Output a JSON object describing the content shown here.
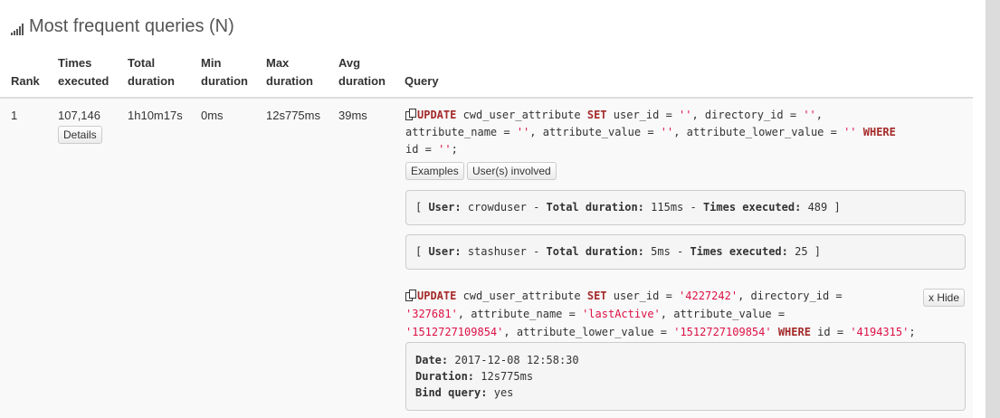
{
  "title": "Most frequent queries (N)",
  "columns": {
    "rank": "Rank",
    "times_executed": [
      "Times",
      "executed"
    ],
    "total_duration": [
      "Total",
      "duration"
    ],
    "min_duration": [
      "Min",
      "duration"
    ],
    "max_duration": [
      "Max",
      "duration"
    ],
    "avg_duration": [
      "Avg",
      "duration"
    ],
    "query": "Query"
  },
  "row": {
    "rank": "1",
    "times_executed": "107,146",
    "total_duration": "1h10m17s",
    "min_duration": "0ms",
    "max_duration": "12s775ms",
    "avg_duration": "39ms",
    "details_button": "Details"
  },
  "query": {
    "line1": {
      "k1": "UPDATE",
      "t1": " cwd_user_attribute ",
      "k2": "SET",
      "t2": " user_id = ",
      "s1": "''",
      "t3": ", directory_id = ",
      "s2": "''",
      "t4": ","
    },
    "line2": {
      "t1": "attribute_name = ",
      "s1": "''",
      "t2": ", attribute_value = ",
      "s2": "''",
      "t3": ", attribute_lower_value = ",
      "s3": "''",
      "k1": " WHERE"
    },
    "line3": {
      "t1": "id = ",
      "s1": "''",
      "t2": ";"
    }
  },
  "buttons": {
    "examples": "Examples",
    "users_involved": "User(s) involved",
    "hide": "x Hide"
  },
  "users": [
    {
      "user_label": "User:",
      "user": "crowduser",
      "total_label": "Total duration:",
      "total": "115ms",
      "times_label": "Times executed:",
      "times": "489"
    },
    {
      "user_label": "User:",
      "user": "stashuser",
      "total_label": "Total duration:",
      "total": "5ms",
      "times_label": "Times executed:",
      "times": "25"
    }
  ],
  "example": {
    "line1": {
      "k1": "UPDATE",
      "t1": " cwd_user_attribute ",
      "k2": "SET",
      "t2": " user_id = ",
      "s1": "'4227242'",
      "t3": ", directory_id ="
    },
    "line2": {
      "s1": "'327681'",
      "t1": ", attribute_name = ",
      "s2": "'lastActive'",
      "t2": ", attribute_value ="
    },
    "line3": {
      "s1": "'1512727109854'",
      "t1": ", attribute_lower_value = ",
      "s2": "'1512727109854'",
      "k1": " WHERE",
      "t2": " id = ",
      "s3": "'4194315'",
      "t3": ";"
    },
    "date_label": "Date:",
    "date": "2017-12-08 12:58:30",
    "duration_label": "Duration:",
    "duration": "12s775ms",
    "bind_label": "Bind query:",
    "bind": "yes"
  }
}
